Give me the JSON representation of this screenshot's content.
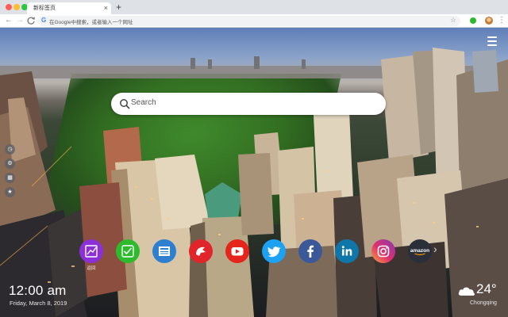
{
  "browser": {
    "tab_title": "新标签页",
    "tab_close": "×",
    "new_tab": "+",
    "omnibox_placeholder": "在Google中搜索，或者输入一个网址",
    "nav": {
      "back": "←",
      "forward": "→",
      "reload": "C"
    }
  },
  "page": {
    "search_placeholder": "Search",
    "clock": "12:00 am",
    "date": "Friday, March 8, 2019",
    "temperature": "24°",
    "city": "Chongqing",
    "shortcuts": [
      {
        "name": "chart",
        "label": "返回",
        "color": "#8b2fd6",
        "icon": "chart-icon"
      },
      {
        "name": "check",
        "label": "",
        "color": "#2dbb2d",
        "icon": "check-icon"
      },
      {
        "name": "news",
        "label": "",
        "color": "#2f7fd0",
        "icon": "news-icon"
      },
      {
        "name": "game",
        "label": "",
        "color": "#e0262a",
        "icon": "game-icon"
      },
      {
        "name": "youtube",
        "label": "",
        "color": "#e5241c",
        "icon": "youtube-icon"
      },
      {
        "name": "twitter",
        "label": "",
        "color": "#1da1f2",
        "icon": "twitter-icon"
      },
      {
        "name": "facebook",
        "label": "",
        "color": "#3b5998",
        "icon": "facebook-icon"
      },
      {
        "name": "linkedin",
        "label": "",
        "color": "#0e76a8",
        "icon": "linkedin-icon"
      },
      {
        "name": "instagram",
        "label": "",
        "color": "#c13584",
        "icon": "instagram-icon"
      },
      {
        "name": "amazon",
        "label": "",
        "color": "#2a2f3a",
        "icon": "amazon-icon",
        "text": "amazon"
      }
    ]
  }
}
